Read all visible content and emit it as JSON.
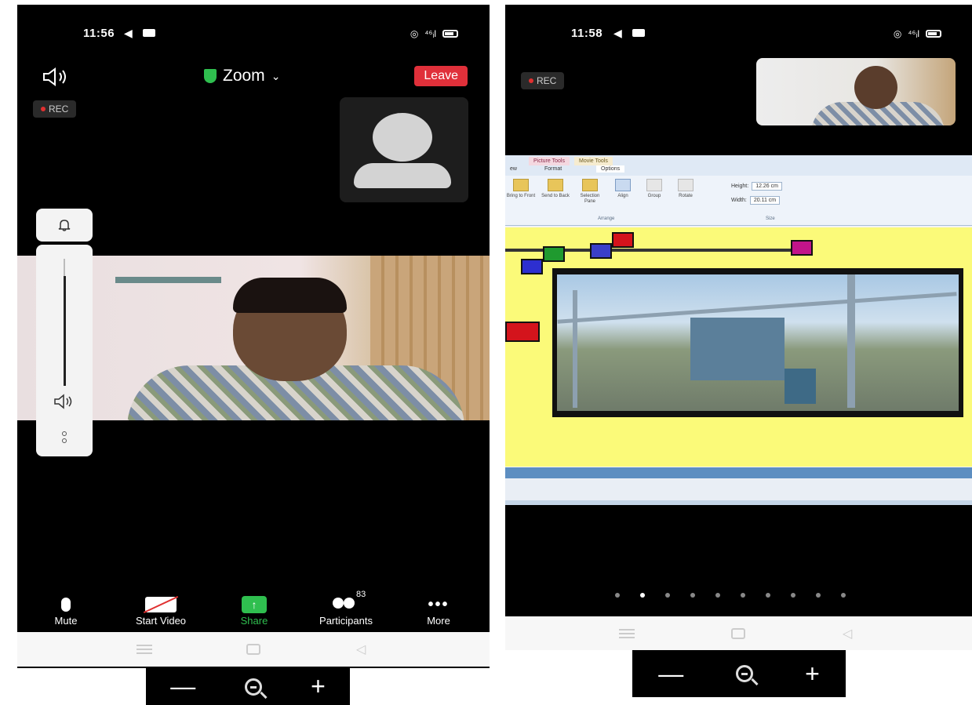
{
  "left": {
    "status": {
      "time": "11:56",
      "signal_text": "⁴⁶ᵢl"
    },
    "rec_label": "REC",
    "title": "Zoom",
    "leave_label": "Leave",
    "toolbar": [
      {
        "label": "Mute",
        "icon": "mic-icon"
      },
      {
        "label": "Start Video",
        "icon": "video-off-icon"
      },
      {
        "label": "Share",
        "icon": "share-icon"
      },
      {
        "label": "Participants",
        "icon": "participants-icon",
        "count": "83"
      },
      {
        "label": "More",
        "icon": "more-icon"
      }
    ],
    "zoom_controls": {
      "minus": "—",
      "plus": "+"
    }
  },
  "right": {
    "status": {
      "time": "11:58",
      "signal_text": "⁴⁶ᵢl"
    },
    "rec_label": "REC",
    "ribbon": {
      "context_tabs": [
        "Picture Tools",
        "Movie Tools"
      ],
      "tabs": [
        "ew",
        "Format",
        "Options"
      ],
      "buttons": [
        "Bring to Front",
        "Send to Back",
        "Selection Pane",
        "Align",
        "Group",
        "Rotate"
      ],
      "height_label": "Height:",
      "height_value": "12.26 cm",
      "width_label": "Width:",
      "width_value": "20.11 cm",
      "arrange_label": "Arrange",
      "size_label": "Size"
    },
    "page_dots": 10,
    "active_dot": 1,
    "zoom_controls": {
      "minus": "—",
      "plus": "+"
    }
  },
  "colors": {
    "leave": "#e0303a",
    "share": "#2fbf4f",
    "rec_dot": "#e03030",
    "slide_bg": "#fbfa79"
  }
}
